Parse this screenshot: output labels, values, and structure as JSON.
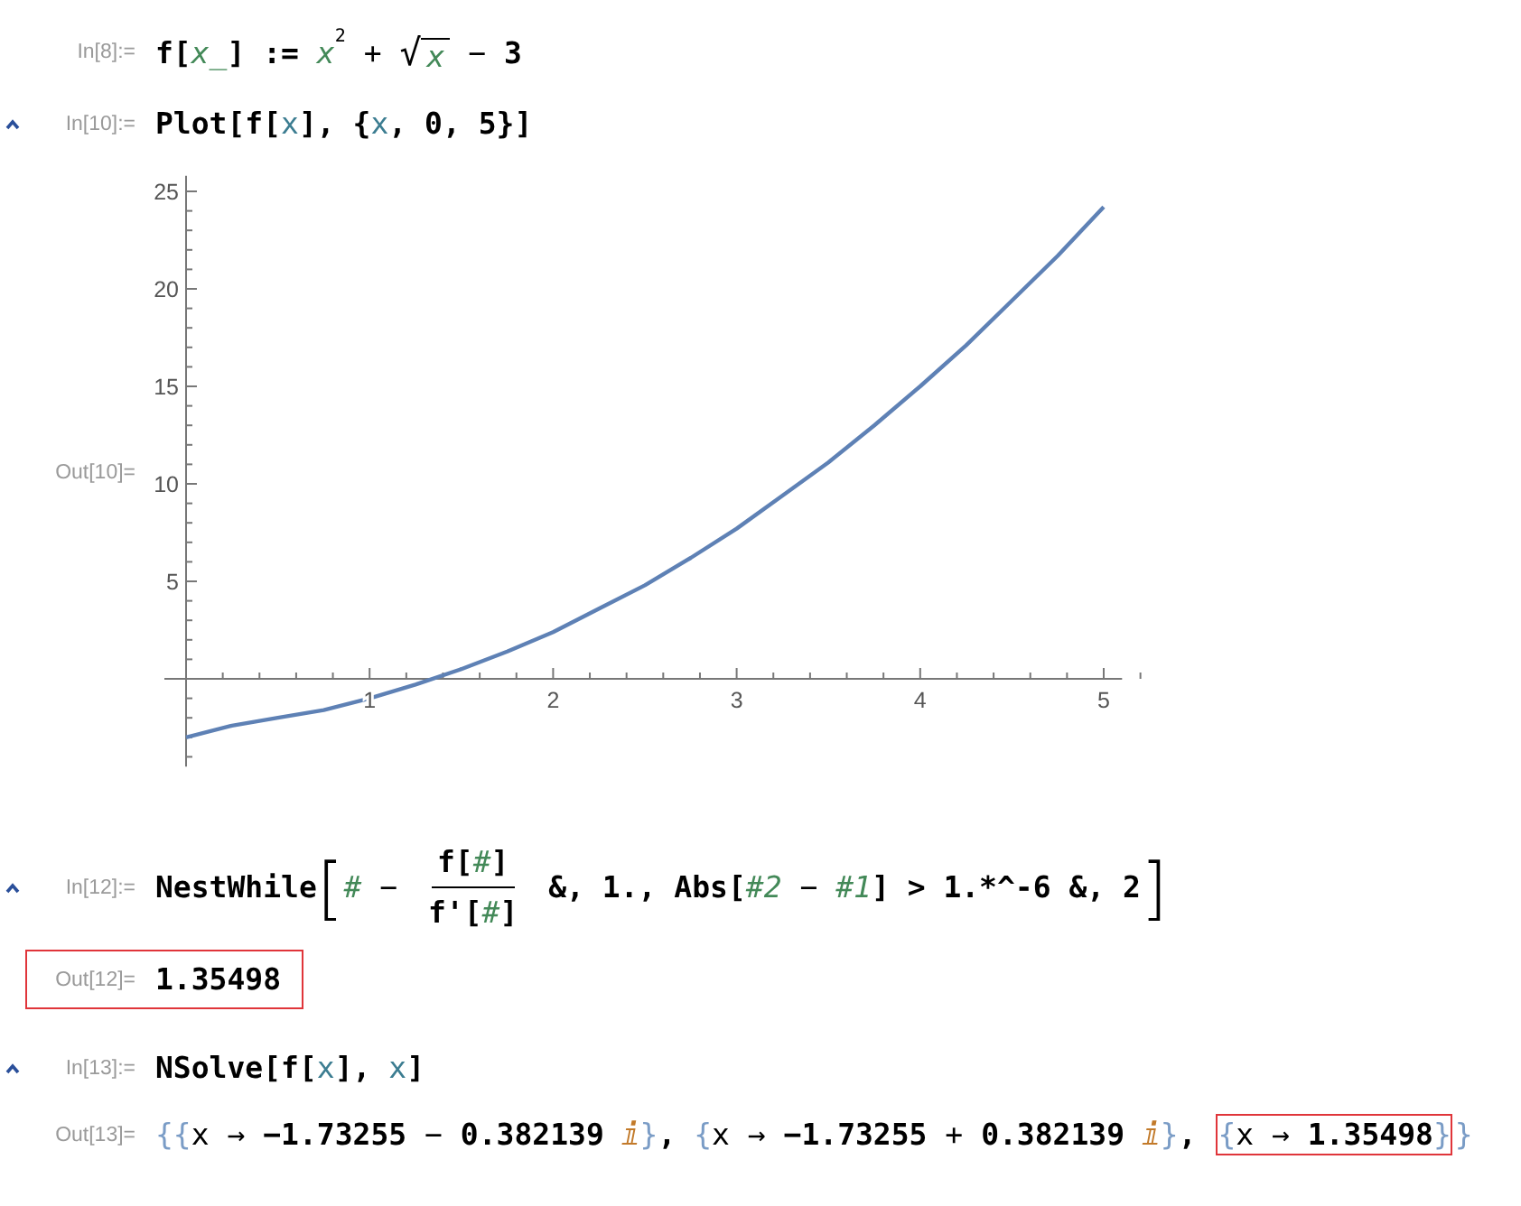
{
  "cells": [
    {
      "label": "In[8]:=",
      "kind": "input",
      "toggle": false,
      "highlighted": false,
      "segments": [
        {
          "highlighted": false,
          "tokens": [
            {
              "kind": "code",
              "text": "f["
            },
            {
              "kind": "pattern",
              "text": "x_"
            },
            {
              "kind": "code",
              "text": "] := "
            },
            {
              "kind": "pattern",
              "text": "x"
            },
            {
              "kind": "sup",
              "text": "2"
            },
            {
              "kind": "op",
              "text": " + "
            },
            {
              "kind": "sqrt",
              "text": "√",
              "children": [
                {
                  "kind": "pattern",
                  "text": "x"
                }
              ]
            },
            {
              "kind": "op",
              "text": " − "
            },
            {
              "kind": "code",
              "text": "3"
            }
          ]
        }
      ]
    },
    {
      "label": "In[10]:=",
      "kind": "input",
      "toggle": true,
      "highlighted": false,
      "segments": [
        {
          "highlighted": false,
          "tokens": [
            {
              "kind": "code",
              "text": "Plot[f["
            },
            {
              "kind": "var",
              "text": "x"
            },
            {
              "kind": "code",
              "text": "], {"
            },
            {
              "kind": "var",
              "text": "x"
            },
            {
              "kind": "code",
              "text": ", 0, 5}]"
            }
          ]
        }
      ]
    },
    {
      "label": "Out[10]=",
      "kind": "plot",
      "toggle": false,
      "highlighted": false,
      "chart_data": {
        "type": "line",
        "x": [
          0,
          0.25,
          0.5,
          0.75,
          1,
          1.25,
          1.5,
          1.75,
          2,
          2.25,
          2.5,
          2.75,
          3,
          3.25,
          3.5,
          3.75,
          4,
          4.25,
          4.5,
          4.75,
          5
        ],
        "series": [
          {
            "color": "#5e81b5",
            "values": [
              -3,
              -2.4,
              -2,
              -1.6,
              -1,
              -0.3,
              0.5,
              1.4,
              2.4,
              3.6,
              4.8,
              6.2,
              7.7,
              9.4,
              11.1,
              13,
              15,
              17.1,
              19.4,
              21.7,
              24.2
            ]
          }
        ],
        "xlim": [
          0,
          5.1
        ],
        "ylim": [
          -4.5,
          25.8
        ],
        "xticks": [
          1,
          2,
          3,
          4,
          5
        ],
        "yticks": [
          5,
          10,
          15,
          20,
          25
        ]
      }
    },
    {
      "label": "In[12]:=",
      "kind": "input",
      "toggle": true,
      "highlighted": false,
      "segments": [
        {
          "highlighted": false,
          "tokens": [
            {
              "kind": "code",
              "text": "NestWhile"
            },
            {
              "kind": "bigbracket",
              "text": "["
            },
            {
              "kind": "slot",
              "text": "#"
            },
            {
              "kind": "op",
              "text": " − "
            },
            {
              "kind": "frac",
              "num": [
                {
                  "kind": "code",
                  "text": "f["
                },
                {
                  "kind": "slot",
                  "text": "#"
                },
                {
                  "kind": "code",
                  "text": "]"
                }
              ],
              "den": [
                {
                  "kind": "code",
                  "text": "f'["
                },
                {
                  "kind": "slot",
                  "text": "#"
                },
                {
                  "kind": "code",
                  "text": "]"
                }
              ]
            },
            {
              "kind": "code",
              "text": " &, 1., Abs["
            },
            {
              "kind": "slot",
              "text": "#2"
            },
            {
              "kind": "op",
              "text": " − "
            },
            {
              "kind": "slot",
              "text": "#1"
            },
            {
              "kind": "code",
              "text": "] > 1.*^-6 &, 2"
            },
            {
              "kind": "bigbracket",
              "text": "]"
            }
          ]
        }
      ]
    },
    {
      "label": "Out[12]=",
      "kind": "output",
      "toggle": false,
      "highlighted": true,
      "segments": [
        {
          "highlighted": false,
          "tokens": [
            {
              "kind": "code",
              "text": "1.35498"
            }
          ]
        }
      ]
    },
    {
      "label": "In[13]:=",
      "kind": "input",
      "toggle": true,
      "highlighted": false,
      "segments": [
        {
          "highlighted": false,
          "tokens": [
            {
              "kind": "code",
              "text": "NSolve[f["
            },
            {
              "kind": "var",
              "text": "x"
            },
            {
              "kind": "code",
              "text": "], "
            },
            {
              "kind": "var",
              "text": "x"
            },
            {
              "kind": "code",
              "text": "]"
            }
          ]
        }
      ]
    },
    {
      "label": "Out[13]=",
      "kind": "output",
      "toggle": false,
      "highlighted": false,
      "segments": [
        {
          "highlighted": false,
          "tokens": [
            {
              "kind": "brace",
              "text": "{{"
            },
            {
              "kind": "plain",
              "text": "x → "
            },
            {
              "kind": "code",
              "text": "−1.73255"
            },
            {
              "kind": "op",
              "text": " − "
            },
            {
              "kind": "code",
              "text": "0.382139 "
            },
            {
              "kind": "imag",
              "text": "ⅈ"
            },
            {
              "kind": "brace",
              "text": "}"
            },
            {
              "kind": "code",
              "text": ", "
            },
            {
              "kind": "brace",
              "text": "{"
            },
            {
              "kind": "plain",
              "text": "x → "
            },
            {
              "kind": "code",
              "text": "−1.73255"
            },
            {
              "kind": "op",
              "text": " + "
            },
            {
              "kind": "code",
              "text": "0.382139 "
            },
            {
              "kind": "imag",
              "text": "ⅈ"
            },
            {
              "kind": "brace",
              "text": "}"
            },
            {
              "kind": "code",
              "text": ", "
            }
          ]
        },
        {
          "highlighted": true,
          "tokens": [
            {
              "kind": "brace",
              "text": "{"
            },
            {
              "kind": "plain",
              "text": "x → "
            },
            {
              "kind": "code",
              "text": "1.35498"
            },
            {
              "kind": "brace",
              "text": "}"
            }
          ]
        },
        {
          "highlighted": false,
          "tokens": [
            {
              "kind": "brace",
              "text": "}"
            }
          ]
        }
      ]
    }
  ]
}
